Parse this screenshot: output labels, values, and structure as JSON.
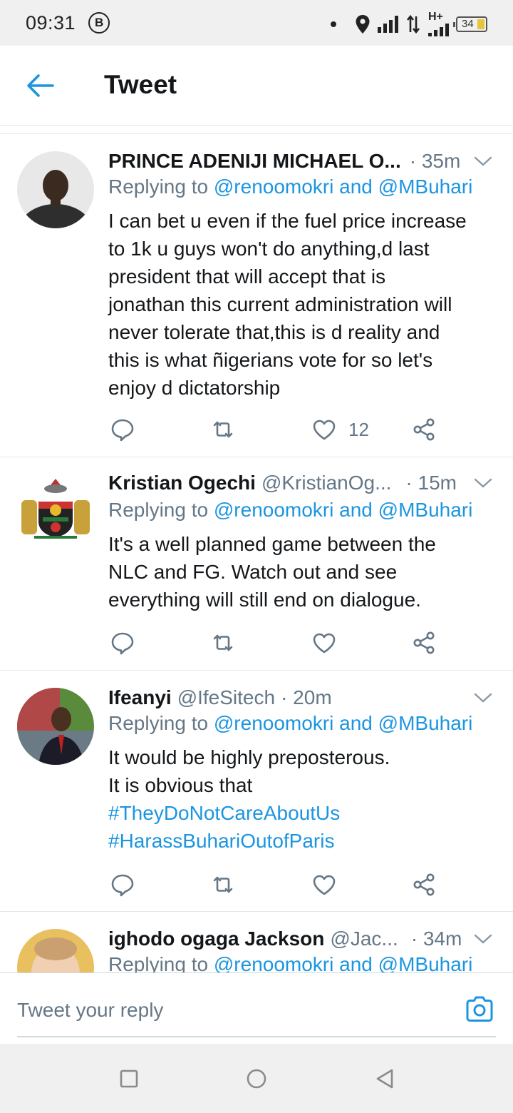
{
  "status_bar": {
    "time": "09:31",
    "b_badge": "B",
    "network_type": "H+",
    "battery_level": "34",
    "battery_color": "#e5c53a"
  },
  "header": {
    "title": "Tweet",
    "back_icon": "arrow-left-icon",
    "accent_color": "#1b95e0"
  },
  "tweets": [
    {
      "name": "PRINCE ADENIJI MICHAEL O...",
      "handle": "",
      "time": "· 35m",
      "replying_prefix": "Replying to ",
      "mention1": "@renoomokri",
      "conjunction": " and ",
      "mention2": "@MBuhari",
      "text_lines": [
        "I can bet u even if the fuel price increase",
        "to 1k u guys won't do anything,d last",
        "president that will accept that is",
        "jonathan this current administration will",
        "never tolerate that,this is d reality and",
        "this is what ñigerians vote for so let's",
        "enjoy d dictatorship"
      ],
      "like_count": "12"
    },
    {
      "name": "Kristian Ogechi",
      "handle": "@KristianOg...",
      "time": "· 15m",
      "replying_prefix": "Replying to ",
      "mention1": "@renoomokri",
      "conjunction": " and ",
      "mention2": "@MBuhari",
      "text_lines": [
        "It's a well planned game between the",
        "NLC and FG. Watch out and see",
        "everything will still end on dialogue."
      ],
      "like_count": ""
    },
    {
      "name": "Ifeanyi",
      "handle": "@IfeSitech",
      "time": "· 20m",
      "replying_prefix": "Replying to ",
      "mention1": "@renoomokri",
      "conjunction": " and ",
      "mention2": "@MBuhari",
      "text_lines": [
        "It would be highly preposterous.",
        "It is obvious that"
      ],
      "hashtags": [
        "#TheyDoNotCareAboutUs",
        "#HarassBuhariOutofParis"
      ],
      "like_count": ""
    },
    {
      "name": "ighodo ogaga Jackson",
      "handle": "@Jac...",
      "time": "· 34m",
      "replying_prefix": "Replying to ",
      "mention1": "@renoomokri",
      "conjunction": " and ",
      "mention2": "@MBuhari"
    }
  ],
  "composer": {
    "placeholder": "Tweet your reply",
    "camera_icon": "camera-icon"
  },
  "nav_bar": {
    "icons": [
      "recent-apps-icon",
      "home-icon",
      "back-icon"
    ]
  }
}
